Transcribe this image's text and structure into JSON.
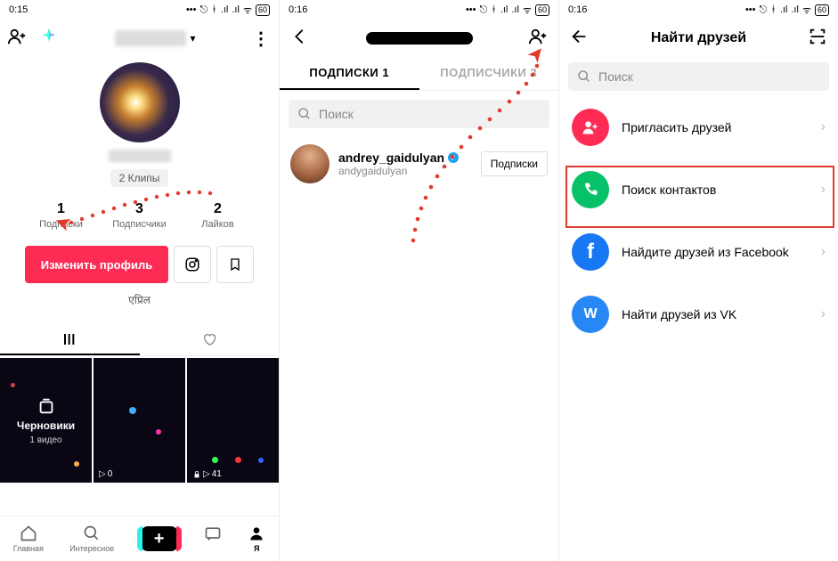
{
  "status": {
    "time1": "0:15",
    "time2": "0:16",
    "time3": "0:16",
    "icons": "...",
    "bt": "",
    "sig": "",
    "wifi": "",
    "batt": "60"
  },
  "s1": {
    "clips_pill": "2 Клипы",
    "stats": [
      {
        "num": "1",
        "lbl": "Подписки"
      },
      {
        "num": "3",
        "lbl": "Подписчики"
      },
      {
        "num": "2",
        "lbl": "Лайков"
      }
    ],
    "edit": "Изменить профиль",
    "bio": "एप्रिल",
    "drafts_title": "Черновики",
    "drafts_sub": "1 видео",
    "play1": "0",
    "play2": "41",
    "nav": {
      "home": "Главная",
      "discover": "Интересное",
      "inbox": "",
      "me": "Я"
    }
  },
  "s2": {
    "tab_following": "ПОДПИСКИ 1",
    "tab_followers": "ПОДПИСЧИКИ 3",
    "search_ph": "Поиск",
    "user_name": "andrey_gaidulyan",
    "user_handle": "andygaidulyan",
    "btn": "Подписки"
  },
  "s3": {
    "title": "Найти друзей",
    "search_ph": "Поиск",
    "opt_invite": "Пригласить друзей",
    "opt_contacts": "Поиск контактов",
    "opt_fb": "Найдите друзей из Facebook",
    "opt_vk": "Найти друзей из VK"
  }
}
